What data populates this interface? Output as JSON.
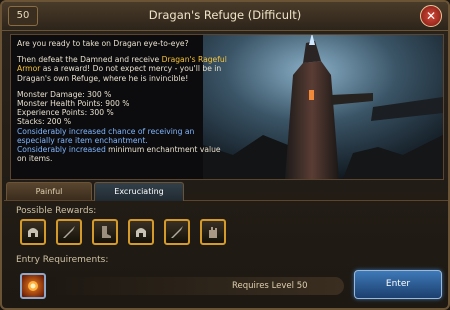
{
  "window": {
    "level": "50",
    "title": "Dragan's Refuge (Difficult)",
    "close_icon": "close-icon"
  },
  "description": {
    "intro": "Are you ready to take on Dragan eye-to-eye?",
    "challenge_part1": "Then defeat the Damned and receive ",
    "reward_name": "Dragan's Rageful Armor",
    "challenge_part2": " as a reward! Do not expect mercy - you'll be in Dragan's own Refuge, where he is invincible!",
    "stats": [
      "Monster Damage: 300 %",
      "Monster Health Points: 900 %",
      "Experience Points: 300 %",
      "Stacks: 200 %"
    ],
    "bonus1": "Considerably increased chance of receiving an especially rare item enchantment.",
    "bonus2_highlight": "Considerably increased",
    "bonus2_rest": " minimum enchantment value on items."
  },
  "tabs": [
    {
      "label": "Painful",
      "active": false
    },
    {
      "label": "Excruciating",
      "active": true
    }
  ],
  "rewards": {
    "label": "Possible Rewards:",
    "items": [
      "helmet-icon",
      "weapon-icon",
      "boots-icon",
      "helmet-icon",
      "weapon-icon",
      "gloves-icon"
    ]
  },
  "requirements": {
    "label": "Entry Requirements:",
    "icon": "fire-orb-icon",
    "text": "Requires Level 50"
  },
  "enter_button": "Enter",
  "colors": {
    "highlight_yellow": "#f5c238",
    "highlight_blue": "#7fb6ff",
    "gold_border": "#d49b2b"
  }
}
